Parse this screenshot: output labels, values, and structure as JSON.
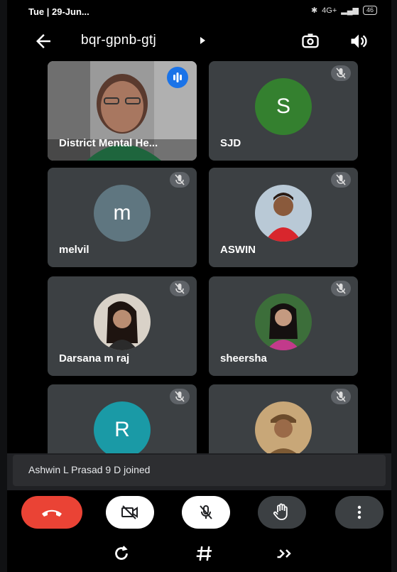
{
  "status": {
    "time": "Tue | 29-Jun...",
    "battery": "46",
    "network": "4G+"
  },
  "header": {
    "meeting_code": "bqr-gpnb-gtj"
  },
  "participants": [
    {
      "name": "District Mental He...",
      "type": "video",
      "speaking": true
    },
    {
      "name": "SJD",
      "type": "letter",
      "letter": "S",
      "avatar_color": "#34802f",
      "muted": true
    },
    {
      "name": "melvil",
      "type": "letter",
      "letter": "m",
      "avatar_color": "#5f7680",
      "muted": true
    },
    {
      "name": "ASWIN",
      "type": "photo",
      "muted": true
    },
    {
      "name": "Darsana m raj",
      "type": "photo",
      "muted": true
    },
    {
      "name": "sheersha",
      "type": "photo",
      "muted": true
    },
    {
      "name": "",
      "type": "letter",
      "letter": "R",
      "avatar_color": "#1a9aa6",
      "muted": true
    },
    {
      "name": "",
      "type": "photo",
      "muted": true
    }
  ],
  "toast": {
    "message": "Ashwin L Prasad 9 D joined"
  },
  "controls": {
    "end_call_color": "#ea4335"
  }
}
